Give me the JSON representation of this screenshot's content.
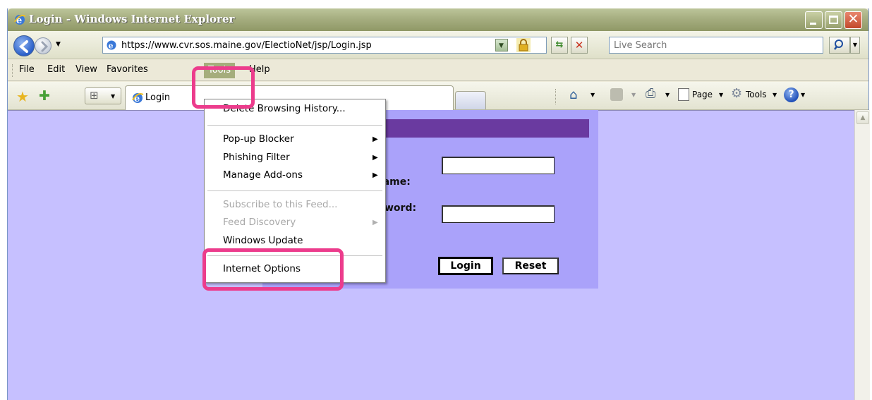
{
  "window": {
    "title": "Login - Windows Internet Explorer"
  },
  "address_bar": {
    "url": "https://www.cvr.sos.maine.gov/ElectioNet/jsp/Login.jsp",
    "search_placeholder": "Live Search"
  },
  "menu": {
    "items": [
      "File",
      "Edit",
      "View",
      "Favorites",
      "Tools",
      "Help"
    ],
    "active": "Tools"
  },
  "tabs": {
    "current_label": "Login"
  },
  "command_bar": {
    "page_label": "Page",
    "tools_label": "Tools"
  },
  "tools_menu": {
    "items": [
      {
        "label": "Delete Browsing History...",
        "enabled": true,
        "submenu": false
      },
      {
        "label": "Pop-up Blocker",
        "enabled": true,
        "submenu": true
      },
      {
        "label": "Phishing Filter",
        "enabled": true,
        "submenu": true
      },
      {
        "label": "Manage Add-ons",
        "enabled": true,
        "submenu": true
      },
      {
        "label": "Subscribe to this Feed...",
        "enabled": false,
        "submenu": false
      },
      {
        "label": "Feed Discovery",
        "enabled": false,
        "submenu": true
      },
      {
        "label": "Windows Update",
        "enabled": true,
        "submenu": false
      },
      {
        "label": "Internet Options",
        "enabled": true,
        "submenu": false
      }
    ]
  },
  "login_form": {
    "username_label": "User Name:",
    "password_label": "Password:",
    "login_button": "Login",
    "reset_button": "Reset"
  },
  "colors": {
    "page_background": "#c6c0ff",
    "panel_background": "#aaa2fa",
    "panel_header": "#6a3aa0",
    "highlight": "#ec3c8c"
  }
}
